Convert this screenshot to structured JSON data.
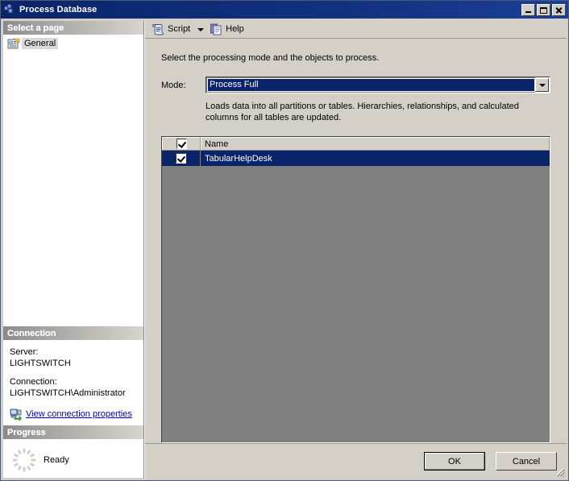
{
  "window": {
    "title": "Process Database",
    "icon": "process-database-icon",
    "buttons": {
      "minimize": "Minimize",
      "maximize": "Maximize",
      "close": "Close"
    }
  },
  "left_pane": {
    "select_page": {
      "header": "Select a page",
      "items": [
        {
          "label": "General",
          "icon": "page-icon",
          "selected": true
        }
      ]
    },
    "connection": {
      "header": "Connection",
      "server_label": "Server:",
      "server_value": "LIGHTSWITCH",
      "connection_label": "Connection:",
      "connection_value": "LIGHTSWITCH\\Administrator",
      "link_label": "View connection properties",
      "link_icon": "server-connection-icon",
      "link_color": "#0000cc"
    },
    "progress": {
      "header": "Progress",
      "status": "Ready",
      "spinner_icon": "progress-spinner-icon"
    }
  },
  "toolbar": {
    "script": {
      "label": "Script",
      "icon": "script-icon",
      "dropdown_icon": "chevron-down-icon"
    },
    "help": {
      "label": "Help",
      "icon": "help-icon"
    }
  },
  "main": {
    "intro": "Select the processing mode and the objects to process.",
    "mode_label": "Mode:",
    "mode_value": "Process Full",
    "mode_options": [
      "Process Full"
    ],
    "mode_description": "Loads data into all partitions or tables. Hierarchies, relationships, and calculated columns for all tables are updated.",
    "grid": {
      "columns": [
        "",
        "Name"
      ],
      "header_checkbox_checked": true,
      "rows": [
        {
          "checked": true,
          "name": "TabularHelpDesk",
          "selected": true
        }
      ]
    }
  },
  "footer": {
    "ok_label": "OK",
    "cancel_label": "Cancel",
    "resize_grip": "resize-grip-icon"
  },
  "colors": {
    "titlebar": "#0a246a",
    "selection": "#0a246a",
    "dialog_face": "#d4d0c8",
    "grid_empty": "#808080",
    "link": "#0000cc"
  }
}
